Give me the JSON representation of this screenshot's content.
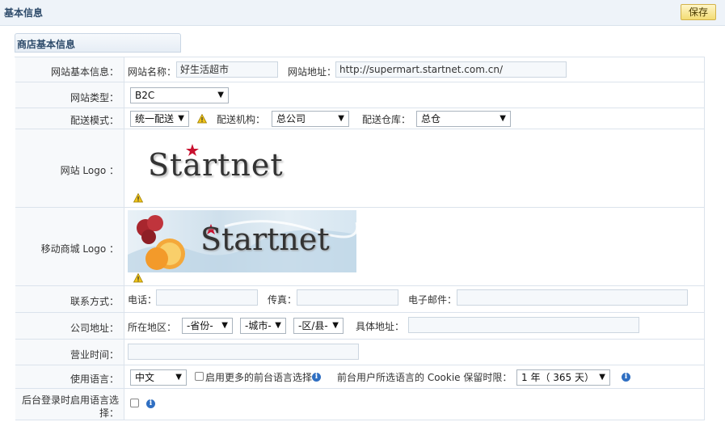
{
  "header": {
    "title": "基本信息",
    "save_label": "保存"
  },
  "section": {
    "title": "商店基本信息"
  },
  "site_info": {
    "label": "网站基本信息：",
    "name_label": "网站名称：",
    "name_value": "好生活超市",
    "url_label": "网站地址：",
    "url_value": "http://supermart.startnet.com.cn/"
  },
  "site_type": {
    "label": "网站类型：",
    "value": "B2C"
  },
  "delivery": {
    "label": "配送模式：",
    "mode_value": "统一配送",
    "org_label": "配送机构：",
    "org_value": "总公司",
    "warehouse_label": "配送仓库：",
    "warehouse_value": "总仓"
  },
  "site_logo": {
    "label": "网站 Logo ：",
    "logo_text": "Startnet"
  },
  "mobile_logo": {
    "label": "移动商城 Logo ：",
    "logo_text": "Startnet"
  },
  "contact": {
    "label": "联系方式：",
    "phone_label": "电话：",
    "fax_label": "传真：",
    "email_label": "电子邮件："
  },
  "address": {
    "label": "公司地址：",
    "region_label": "所在地区：",
    "province": "-省份-",
    "city": "-城市-",
    "district": "-区/县-",
    "detail_label": "具体地址："
  },
  "hours": {
    "label": "营业时间："
  },
  "language": {
    "label": "使用语言：",
    "value": "中文",
    "more_label": "启用更多的前台语言选择",
    "cookie_label": "前台用户所选语言的 Cookie 保留时限：",
    "cookie_value": "1 年（ 365 天）"
  },
  "admin_lang": {
    "label_line1": "后台登录时启用语言选",
    "label_line2": "择："
  },
  "icons": {
    "warning": "warning-icon",
    "info": "info-icon",
    "dropdown": "chevron-down-icon"
  },
  "colors": {
    "accent": "#2d4a6a",
    "save_button": "#f3dc74",
    "star": "#c8102e"
  }
}
